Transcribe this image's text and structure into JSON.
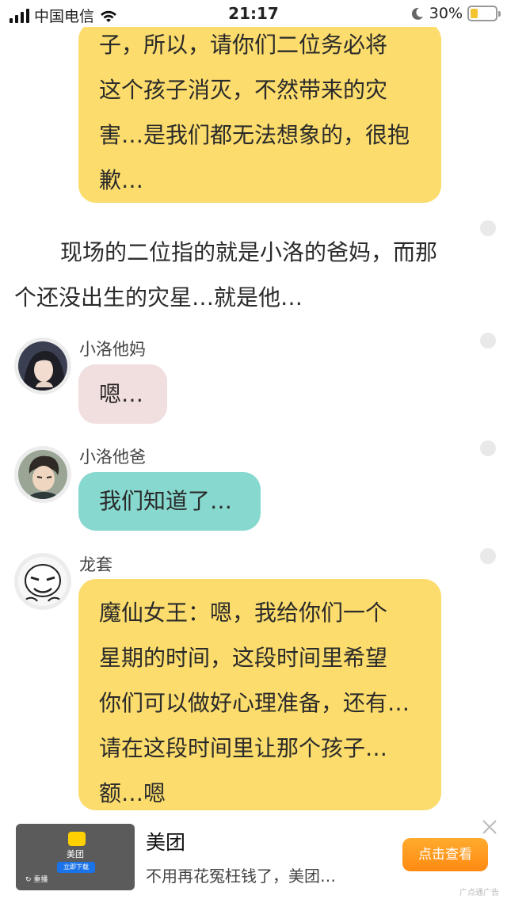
{
  "status_bar": {
    "carrier": "中国电信",
    "time": "21:17",
    "battery_percent": "30%",
    "battery_level": 0.3,
    "icons": [
      "signal-icon",
      "wifi-icon",
      "moon-icon",
      "battery-icon"
    ]
  },
  "chat": {
    "top_bubble": {
      "lines": [
        "子，所以，请你们二位务必将",
        "这个孩子消灭，不然带来的灾",
        "害…是我们都无法想象的，很抱",
        "歉…"
      ]
    },
    "narration": {
      "lines": [
        "现场的二位指的就是小洛的爸妈，而那",
        "个还没出生的灾星…就是他…"
      ]
    },
    "messages": [
      {
        "speaker": "小洛他妈",
        "lines": [
          "嗯…"
        ],
        "color": "#f1dede"
      },
      {
        "speaker": "小洛他爸",
        "lines": [
          "我们知道了…"
        ],
        "color": "#87d8cf"
      },
      {
        "speaker": "龙套",
        "lines": [
          "魔仙女王：嗯，我给你们一个",
          "星期的时间，这段时间里希望",
          "你们可以做好心理准备，还有…",
          "请在这段时间里让那个孩子…",
          "额…嗯"
        ],
        "color": "#fbdc6c"
      }
    ]
  },
  "ad": {
    "thumb_brand": "美团",
    "thumb_download": "立即下载",
    "thumb_replay": "重播",
    "title": "美团",
    "description": "不用再花冤枉钱了，美团…",
    "cta": "点击查看",
    "source": "广点通广告"
  }
}
